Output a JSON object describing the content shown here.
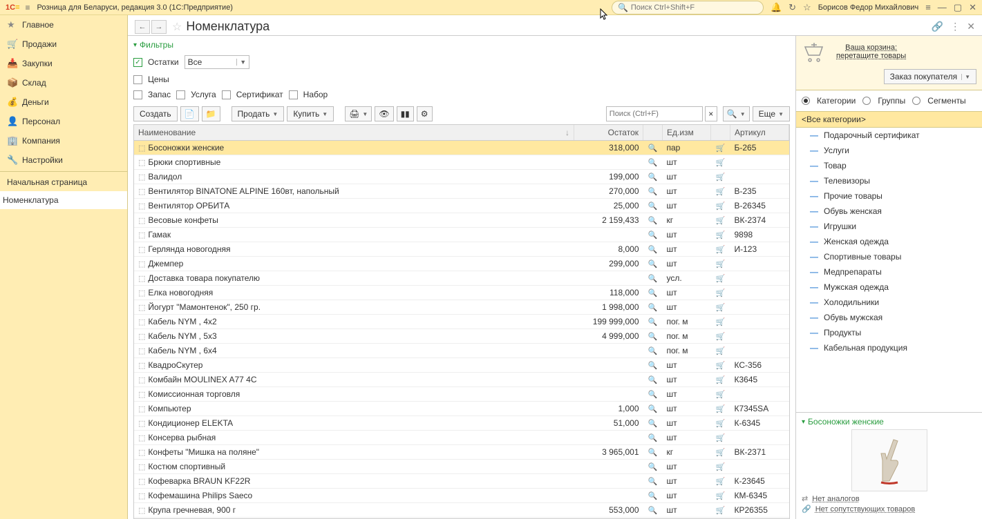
{
  "app": {
    "logo": "1C",
    "title": "Розница для Беларуси, редакция 3.0  (1С:Предприятие)",
    "search_placeholder": "Поиск Ctrl+Shift+F",
    "user": "Борисов Федор Михайлович"
  },
  "nav": {
    "items": [
      "Главное",
      "Продажи",
      "Закупки",
      "Склад",
      "Деньги",
      "Персонал",
      "Компания",
      "Настройки"
    ],
    "bottom": [
      "Начальная страница",
      "Номенклатура"
    ]
  },
  "page": {
    "title": "Номенклатура",
    "filters_label": "Фильтры",
    "balances_label": "Остатки",
    "balances_value": "Все",
    "prices_label": "Цены",
    "stock_label": "Запас",
    "service_label": "Услуга",
    "cert_label": "Сертификат",
    "set_label": "Набор"
  },
  "toolbar": {
    "create": "Создать",
    "sell": "Продать",
    "buy": "Купить",
    "search_placeholder": "Поиск (Ctrl+F)",
    "more": "Еще"
  },
  "table": {
    "headers": {
      "name": "Наименование",
      "balance": "Остаток",
      "unit": "Ед.изм",
      "article": "Артикул"
    },
    "rows": [
      {
        "name": "Босоножки женские",
        "balance": "318,000",
        "unit": "пар",
        "art": "Б-265",
        "selected": true
      },
      {
        "name": "Брюки спортивные",
        "balance": "",
        "unit": "шт",
        "art": ""
      },
      {
        "name": "Валидол",
        "balance": "199,000",
        "unit": "шт",
        "art": ""
      },
      {
        "name": "Вентилятор BINATONE ALPINE 160вт, напольный",
        "balance": "270,000",
        "unit": "шт",
        "art": "В-235"
      },
      {
        "name": "Вентилятор ОРБИТА",
        "balance": "25,000",
        "unit": "шт",
        "art": "В-26345"
      },
      {
        "name": "Весовые конфеты",
        "balance": "2 159,433",
        "unit": "кг",
        "art": "ВК-2374"
      },
      {
        "name": "Гамак",
        "balance": "",
        "unit": "шт",
        "art": "9898"
      },
      {
        "name": "Герлянда новогодняя",
        "balance": "8,000",
        "unit": "шт",
        "art": "И-123"
      },
      {
        "name": "Джемпер",
        "balance": "299,000",
        "unit": "шт",
        "art": ""
      },
      {
        "name": "Доставка товара покупателю",
        "balance": "",
        "unit": "усл.",
        "art": ""
      },
      {
        "name": "Елка новогодняя",
        "balance": "118,000",
        "unit": "шт",
        "art": ""
      },
      {
        "name": "Йогурт \"Мамонтенок\", 250 гр.",
        "balance": "1 998,000",
        "unit": "шт",
        "art": ""
      },
      {
        "name": "Кабель NYM , 4x2",
        "balance": "199 999,000",
        "unit": "пог. м",
        "art": ""
      },
      {
        "name": "Кабель NYM , 5x3",
        "balance": "4 999,000",
        "unit": "пог. м",
        "art": ""
      },
      {
        "name": "Кабель NYM , 6x4",
        "balance": "",
        "unit": "пог. м",
        "art": ""
      },
      {
        "name": "КвадроСкутер",
        "balance": "",
        "unit": "шт",
        "art": "КС-356"
      },
      {
        "name": "Комбайн MOULINEX  A77 4C",
        "balance": "",
        "unit": "шт",
        "art": "К3645"
      },
      {
        "name": "Комиссионная торговля",
        "balance": "",
        "unit": "шт",
        "art": ""
      },
      {
        "name": "Компьютер",
        "balance": "1,000",
        "unit": "шт",
        "art": "К7345SA"
      },
      {
        "name": "Кондиционер ELEKTA",
        "balance": "51,000",
        "unit": "шт",
        "art": "К-6345"
      },
      {
        "name": "Консерва рыбная",
        "balance": "",
        "unit": "шт",
        "art": ""
      },
      {
        "name": "Конфеты \"Мишка на поляне\"",
        "balance": "3 965,001",
        "unit": "кг",
        "art": "ВК-2371"
      },
      {
        "name": "Костюм спортивный",
        "balance": "",
        "unit": "шт",
        "art": ""
      },
      {
        "name": "Кофеварка BRAUN KF22R",
        "balance": "",
        "unit": "шт",
        "art": "К-23645"
      },
      {
        "name": "Кофемашина Philips Saeco",
        "balance": "",
        "unit": "шт",
        "art": "КМ-6345"
      },
      {
        "name": "Крупа гречневая, 900 г",
        "balance": "553,000",
        "unit": "шт",
        "art": "КР26355"
      }
    ]
  },
  "right": {
    "cart_line1": "Ваша корзина:",
    "cart_line2": "перетащите товары",
    "order_btn": "Заказ покупателя",
    "radio_categories": "Категории",
    "radio_groups": "Группы",
    "radio_segments": "Сегменты",
    "cat_head": "<Все категории>",
    "categories": [
      "Подарочный сертификат",
      "Услуги",
      "Товар",
      "Телевизоры",
      "Прочие товары",
      "Обувь женская",
      "Игрушки",
      "Женская одежда",
      "Спортивные товары",
      "Медпрепараты",
      "Мужская одежда",
      "Холодильники",
      "Обувь мужская",
      "Продукты",
      "Кабельная продукция"
    ],
    "preview_title": "Босоножки женские",
    "no_analogues": "Нет аналогов",
    "no_related": "Нет сопутствующих товаров"
  }
}
